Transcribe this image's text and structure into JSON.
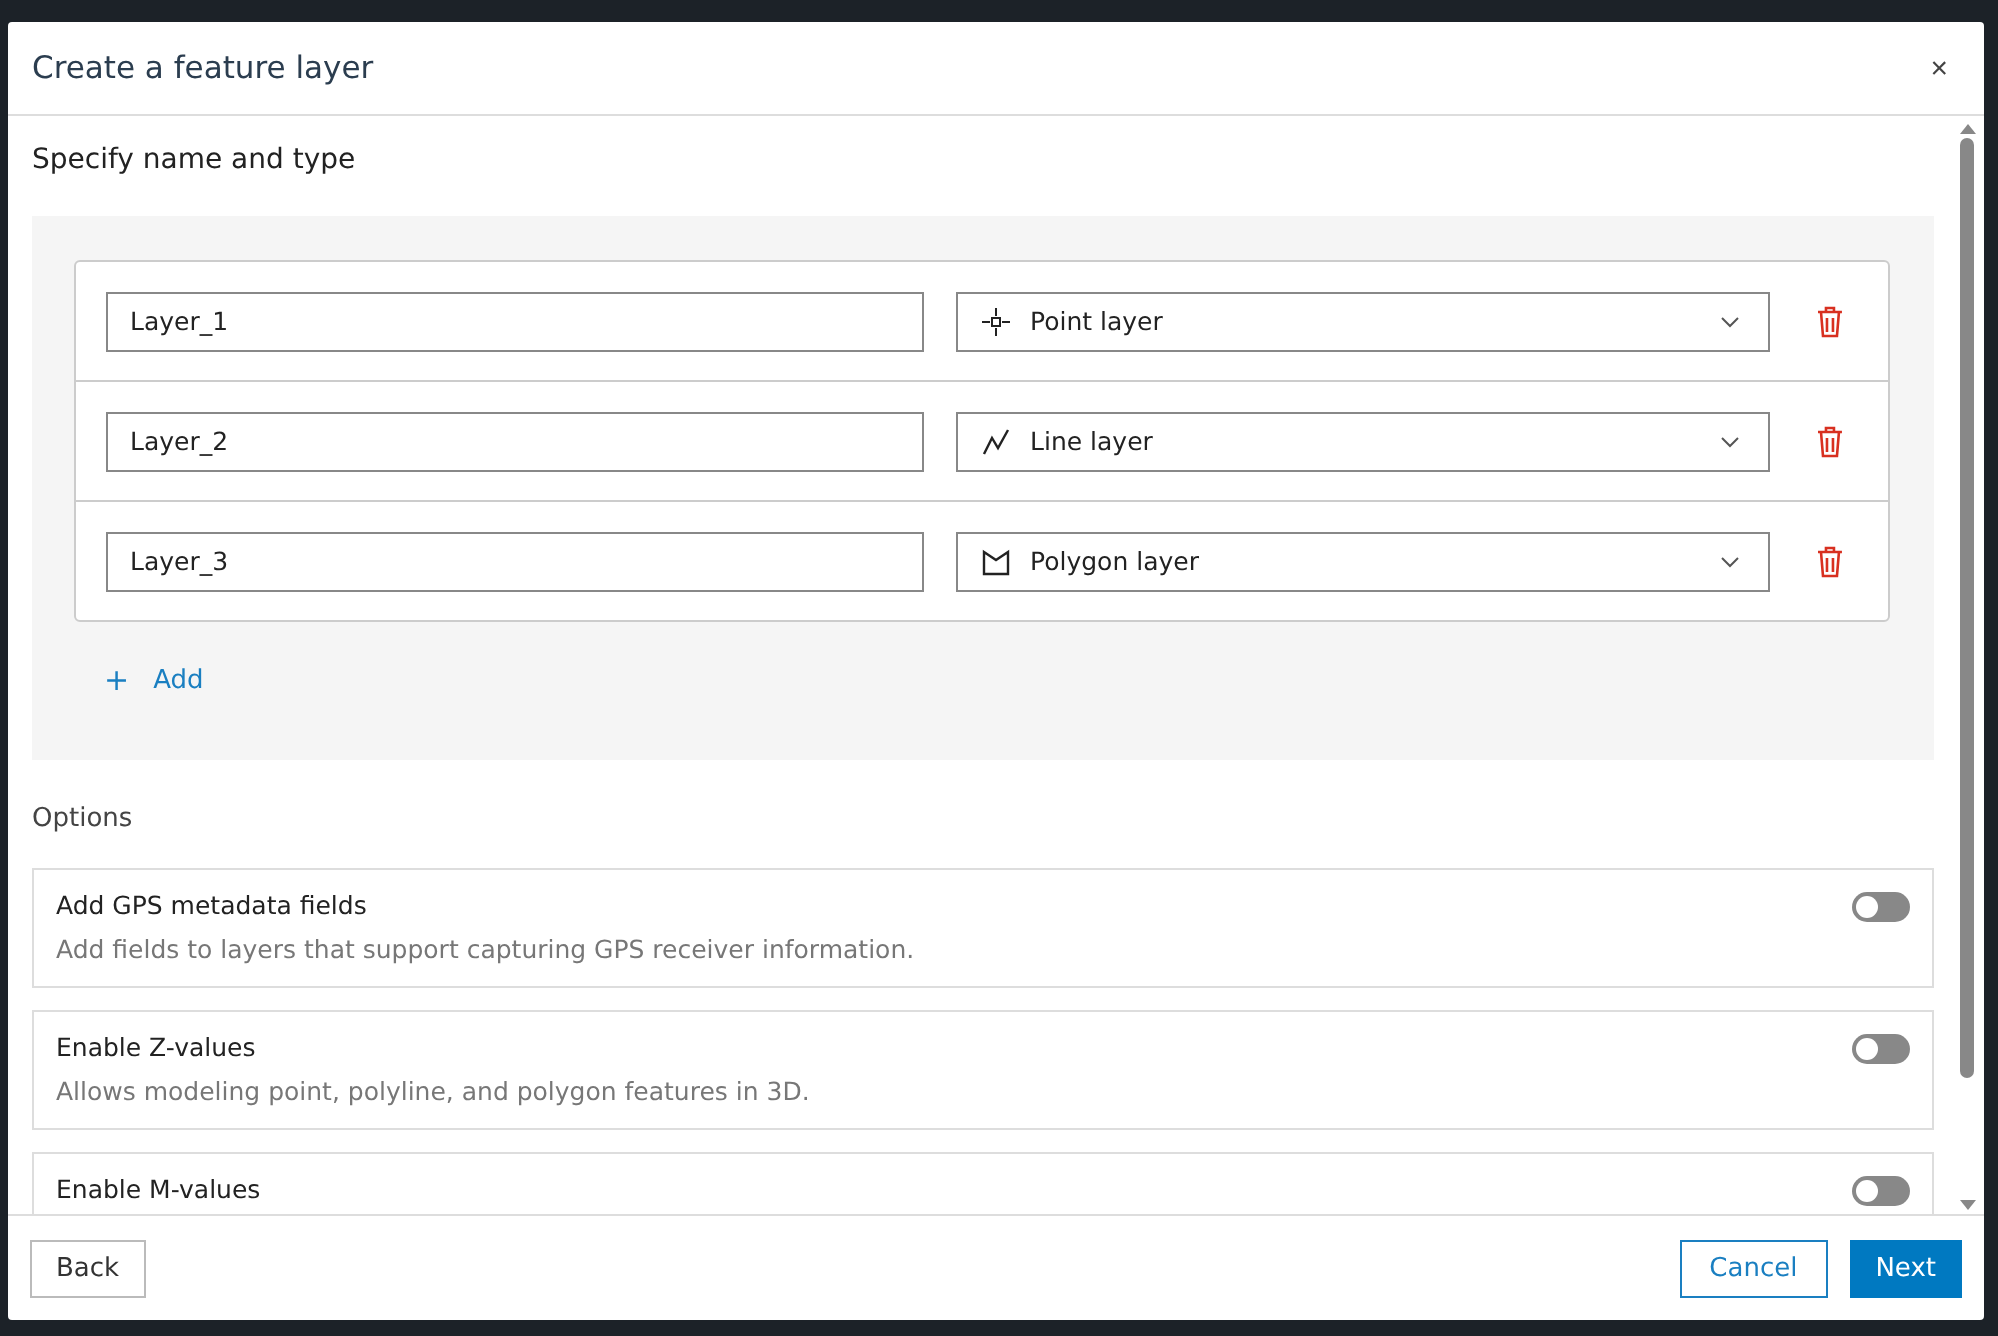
{
  "dialog": {
    "title": "Create a feature layer",
    "close": "×"
  },
  "section": {
    "heading": "Specify name and type"
  },
  "layers": [
    {
      "name": "Layer_1",
      "type_label": "Point layer",
      "kind": "point"
    },
    {
      "name": "Layer_2",
      "type_label": "Line layer",
      "kind": "line"
    },
    {
      "name": "Layer_3",
      "type_label": "Polygon layer",
      "kind": "polygon"
    }
  ],
  "add": {
    "icon": "+",
    "label": "Add"
  },
  "options": {
    "heading": "Options",
    "items": [
      {
        "title": "Add GPS metadata fields",
        "description": "Add fields to layers that support capturing GPS receiver information.",
        "on": false
      },
      {
        "title": "Enable Z-values",
        "description": "Allows modeling point, polyline, and polygon features in 3D.",
        "on": false
      },
      {
        "title": "Enable M-values",
        "on": false
      }
    ]
  },
  "footer": {
    "back": "Back",
    "cancel": "Cancel",
    "next": "Next"
  }
}
